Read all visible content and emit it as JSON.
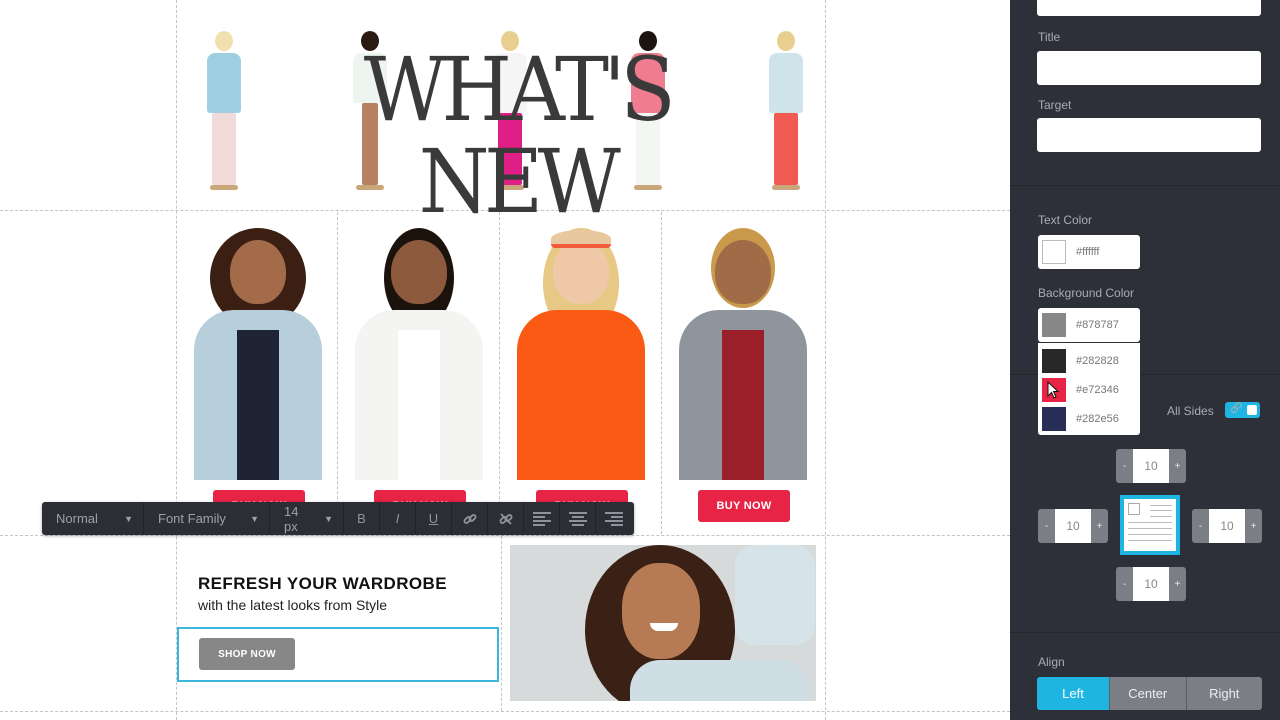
{
  "canvas": {
    "hero": {
      "title": "WHAT'S NEW",
      "models": [
        {
          "top": "#9fd0e2",
          "legs": "#f1dada",
          "hair": "#f0e0b0"
        },
        {
          "top": "#eef4ef",
          "legs": "#b78063",
          "hair": "#2b1a12"
        },
        {
          "top": "#f5f5f5",
          "legs": "#e01f86",
          "hair": "#e8cf8f"
        },
        {
          "top": "#ef7d8f",
          "legs": "#f4f6f2",
          "hair": "#1c1410"
        },
        {
          "top": "#cfe3ea",
          "legs": "#ef5b52",
          "hair": "#e8cf8f"
        }
      ]
    },
    "products": [
      {
        "button_label": "BUY NOW",
        "hair": "#3a1f12",
        "skin": "#a46b4a",
        "jacket": "#b6cfdb",
        "inner": "#1e2434"
      },
      {
        "button_label": "BUY NOW",
        "hair": "#1c120c",
        "skin": "#8d5a3e",
        "jacket": "#f4f4f2",
        "inner": "#ffffff"
      },
      {
        "button_label": "BUY NOW",
        "hair": "#e7c884",
        "skin": "#efc8a7",
        "jacket": "#fb5a14",
        "inner": "#fb5a14"
      },
      {
        "button_label": "BUY NOW",
        "hair": "#c99a4b",
        "skin": "#a06c48",
        "jacket": "#8e959c",
        "inner": "#9a1f2a"
      }
    ],
    "promo": {
      "title": "REFRESH YOUR WARDROBE",
      "subtitle": "with the latest looks from Style",
      "button_label": "SHOP NOW"
    }
  },
  "format_toolbar": {
    "block_style": "Normal",
    "font_family": "Font Family",
    "font_size": "14 px",
    "bold": "B",
    "italic": "I",
    "underline": "U",
    "link_icon": "link-icon",
    "unlink_icon": "unlink-icon"
  },
  "panel": {
    "title_label": "Title",
    "title_value": "",
    "target_label": "Target",
    "target_value": "",
    "text_color": {
      "label": "Text Color",
      "value": "#ffffff"
    },
    "background_color": {
      "label": "Background Color",
      "value": "#878787",
      "options": [
        "#282828",
        "#e72346",
        "#282e56"
      ]
    },
    "padding": {
      "all_sides_label": "All Sides",
      "all_sides_linked": true,
      "top": "10",
      "left": "10",
      "right": "10",
      "bottom": "10",
      "minus": "-",
      "plus": "+"
    },
    "align": {
      "label": "Align",
      "options": [
        "Left",
        "Center",
        "Right"
      ],
      "selected": "Left"
    }
  },
  "colors": {
    "accent": "#1fb5e2",
    "buy_button": "#e72346",
    "panel_bg": "#2d3038",
    "shop_button": "#878787"
  }
}
